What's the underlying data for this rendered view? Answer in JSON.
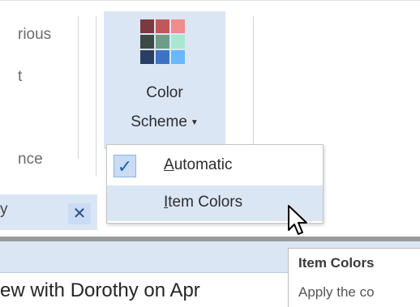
{
  "ribbon": {
    "left_group": {
      "item_previous_fragment": "rious",
      "item_next_fragment": "t",
      "group_label_fragment": "nce"
    },
    "color_scheme": {
      "label_line1": "Color",
      "label_line2": "Scheme",
      "icon": "color-grid-icon",
      "swatches": [
        "#7a3a3f",
        "#c0575b",
        "#f28b8b",
        "#3c4a44",
        "#6e9c86",
        "#a8e8d0",
        "#283f61",
        "#3d73c2",
        "#69b7ff"
      ]
    }
  },
  "menu": {
    "items": [
      {
        "label": "Automatic",
        "mnemonic": "A",
        "rest": "utomatic",
        "checked": true
      },
      {
        "label": "Item Colors",
        "mnemonic": "I",
        "rest": "tem Colors",
        "checked": false,
        "hover": true
      }
    ],
    "check_glyph": "✓"
  },
  "doc_tab": {
    "text_fragment": "y",
    "close_glyph": "✕"
  },
  "email_preview": {
    "text": "ew with Dorothy on Apr"
  },
  "tooltip": {
    "title": "Item Colors",
    "description": "Apply the co"
  },
  "colors": {
    "accent_light": "#dbe6f5",
    "check_blue": "#1f5fb0"
  }
}
